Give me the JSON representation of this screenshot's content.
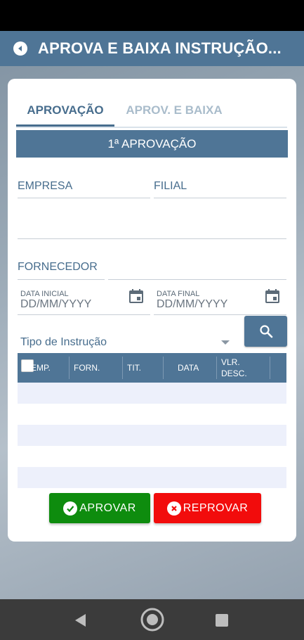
{
  "app_bar": {
    "title": "APROVA E BAIXA INSTRUÇÃO..."
  },
  "tabs": [
    {
      "label": "APROVAÇÃO",
      "active": true
    },
    {
      "label": "APROV. E BAIXA",
      "active": false
    }
  ],
  "section": {
    "header": "1ª APROVAÇÃO"
  },
  "form": {
    "empresa_label": "EMPRESA",
    "filial_label": "FILIAL",
    "fornecedor_label": "FORNECEDOR",
    "data_inicial_label": "DATA INICIAL",
    "data_inicial_placeholder": "DD/MM/YYYY",
    "data_final_label": "DATA FINAL",
    "data_final_placeholder": "DD/MM/YYYY",
    "tipo_instrucao_label": "Tipo de Instrução"
  },
  "table": {
    "columns": [
      "EMP.",
      "FORN.",
      "TIT.",
      "DATA",
      "VLR.",
      "DESC."
    ]
  },
  "actions": {
    "approve_label": "APROVAR",
    "reject_label": "REPROVAR"
  },
  "colors": {
    "primary": "#4f7596",
    "approve": "#0e8c0e",
    "reject": "#f20c0c"
  }
}
